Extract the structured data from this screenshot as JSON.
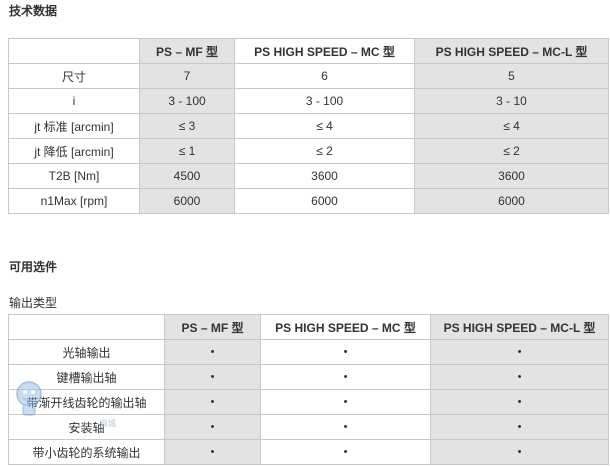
{
  "tech_data": {
    "title": "技术数据",
    "headers": [
      "",
      "PS – MF 型",
      "PS HIGH SPEED – MC 型",
      "PS HIGH SPEED – MC-L 型"
    ],
    "rows": [
      {
        "label": "尺寸",
        "values": [
          "7",
          "6",
          "5"
        ]
      },
      {
        "label": "i",
        "values": [
          "3 - 100",
          "3 - 100",
          "3 - 10"
        ]
      },
      {
        "label": "jt 标准 [arcmin]",
        "values": [
          "≤ 3",
          "≤ 4",
          "≤ 4"
        ]
      },
      {
        "label": "jt 降低 [arcmin]",
        "values": [
          "≤ 1",
          "≤ 2",
          "≤ 2"
        ]
      },
      {
        "label": "T2B [Nm]",
        "values": [
          "4500",
          "3600",
          "3600"
        ]
      },
      {
        "label": "n1Max [rpm]",
        "values": [
          "6000",
          "6000",
          "6000"
        ]
      }
    ]
  },
  "options": {
    "title": "可用选件",
    "subtitle": "输出类型",
    "headers": [
      "",
      "PS – MF 型",
      "PS HIGH SPEED – MC 型",
      "PS HIGH SPEED – MC-L 型"
    ],
    "rows": [
      {
        "label": "光轴输出",
        "values": [
          "•",
          "•",
          "•"
        ]
      },
      {
        "label": "键槽输出轴",
        "values": [
          "•",
          "•",
          "•"
        ]
      },
      {
        "label": "带渐开线齿轮的输出轴",
        "values": [
          "•",
          "•",
          "•"
        ]
      },
      {
        "label": "安装轴",
        "values": [
          "•",
          "•",
          "•"
        ]
      },
      {
        "label": "带小齿轮的系统输出",
        "values": [
          "•",
          "•",
          "•"
        ]
      }
    ]
  },
  "watermark": {
    "text": "商城",
    "icon": "mascot-logo"
  },
  "colors": {
    "shaded_cell": "#e3e3e3",
    "border": "#c8c8c8",
    "text": "#333333"
  }
}
